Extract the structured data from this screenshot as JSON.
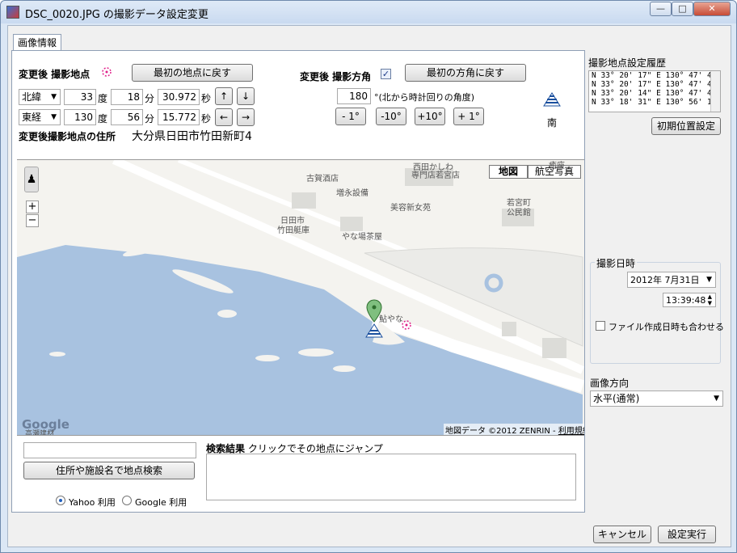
{
  "window": {
    "title": "DSC_0020.JPG の撮影データ設定変更",
    "min_label": "—",
    "max_label": "□",
    "close_label": "✕"
  },
  "tab_label": "画像情報",
  "location": {
    "header": "変更後 撮影地点",
    "reset_button": "最初の地点に戻す",
    "lat_dir": "北緯",
    "lat_deg": "33",
    "lat_min": "18",
    "lat_sec": "30.972",
    "lon_dir": "東経",
    "lon_deg": "130",
    "lon_min": "56",
    "lon_sec": "15.772",
    "deg_unit": "度",
    "min_unit": "分",
    "sec_unit": "秒",
    "up_label": "↑",
    "down_label": "↓",
    "left_label": "←",
    "right_label": "→",
    "address_label": "変更後撮影地点の住所",
    "address_value": "大分県日田市竹田新町4"
  },
  "direction": {
    "header": "変更後 撮影方角",
    "checkbox_mark": "✓",
    "reset_button": "最初の方角に戻す",
    "value": "180",
    "hint": "°(北から時計回りの角度)",
    "btn_m1": "- 1°",
    "btn_m10": "-10°",
    "btn_p10": "+10°",
    "btn_p1": "+ 1°",
    "compass_label": "南"
  },
  "map": {
    "mode_map": "地図",
    "mode_aerial": "航空写真",
    "zoom_in": "+",
    "zoom_out": "−",
    "google": "Google",
    "attribution": "地図データ ©2012 ZENRIN - ",
    "terms": "利用規約",
    "labels": {
      "sake": "古賀酒店",
      "zouei": "増永設備",
      "biyou": "美容新女苑",
      "wakamiya_koen_1": "若宮町",
      "wakamiya_koen_2": "公民館",
      "hitasaki": "日田市",
      "takeda": "竹田艇庫",
      "yanaba": "やな場茶屋",
      "ayu": "鮎やな",
      "nishida_1": "西田かしわ",
      "nishida_2": "専門店若宮店",
      "kenzai": "高瀬建材",
      "point_top": "癒座"
    }
  },
  "search": {
    "input_value": "",
    "button": "住所や施設名で地点検索",
    "results_label": "検索結果",
    "results_hint": "クリックでその地点にジャンプ",
    "yahoo": "Yahoo 利用",
    "google": "Google 利用"
  },
  "history": {
    "title": "撮影地点設定履歴",
    "lines": [
      "N 33° 20' 17\"  E 130° 47' 4",
      "N 33° 20' 17\"  E 130° 47' 4",
      "N 33° 20' 14\"  E 130° 47' 4",
      "N 33° 18' 31\"  E 130° 56' 1"
    ],
    "reset_button": "初期位置設定"
  },
  "datetime": {
    "title": "撮影日時",
    "date": "2012年  7月31日",
    "time": "13:39:48",
    "file_sync": "ファイル作成日時も合わせる"
  },
  "orientation": {
    "title": "画像方向",
    "value": "水平(通常)"
  },
  "footer": {
    "cancel": "キャンセル",
    "apply": "設定実行"
  }
}
